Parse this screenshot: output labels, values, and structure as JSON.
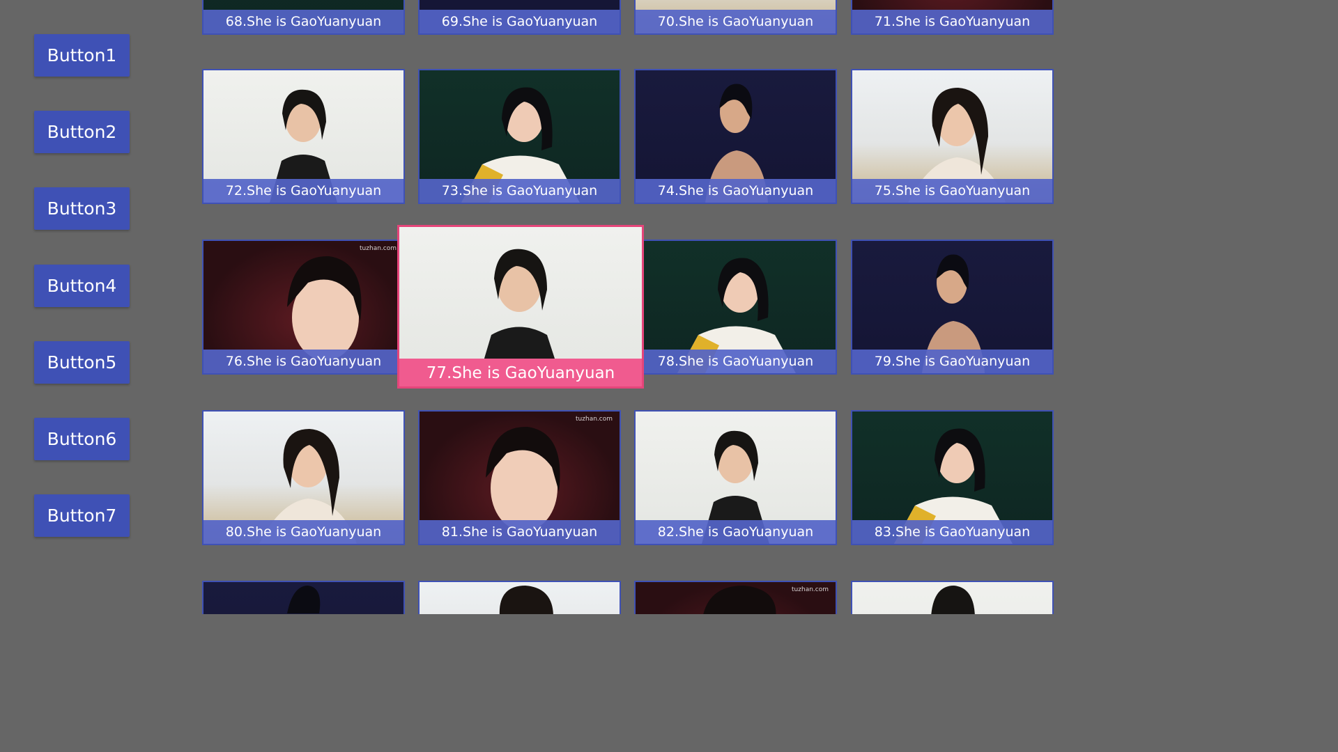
{
  "sidebar": {
    "buttons": [
      "Button1",
      "Button2",
      "Button3",
      "Button4",
      "Button5",
      "Button6",
      "Button7"
    ]
  },
  "grid": {
    "captions": {
      "t68": "68.She is GaoYuanyuan",
      "t69": "69.She is GaoYuanyuan",
      "t70": "70.She is GaoYuanyuan",
      "t71": "71.She is GaoYuanyuan",
      "t72": "72.She is GaoYuanyuan",
      "t73": "73.She is GaoYuanyuan",
      "t74": "74.She is GaoYuanyuan",
      "t75": "75.She is GaoYuanyuan",
      "t76": "76.She is GaoYuanyuan",
      "t77": "77.She is GaoYuanyuan",
      "t78": "78.She is GaoYuanyuan",
      "t79": "79.She is GaoYuanyuan",
      "t80": "80.She is GaoYuanyuan",
      "t81": "81.She is GaoYuanyuan",
      "t82": "82.She is GaoYuanyuan",
      "t83": "83.She is GaoYuanyuan"
    },
    "watermark": "tuzhan.com",
    "focused_tile": "77"
  },
  "colors": {
    "background": "#666666",
    "accent": "#3f51b5",
    "focus": "#e5457a"
  }
}
